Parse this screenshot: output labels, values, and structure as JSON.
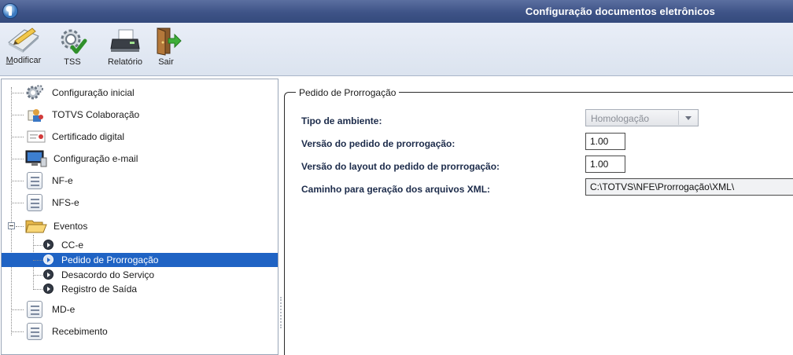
{
  "window": {
    "title": "Configuração documentos eletrônicos"
  },
  "toolbar": {
    "modificar": {
      "label_underlined": "M",
      "label_rest": "odificar",
      "icon": "pencil-check-icon"
    },
    "tss": {
      "label": "TSS",
      "icon": "gear-check-icon"
    },
    "relatorio": {
      "label": "Relatório",
      "icon": "printer-icon"
    },
    "sair": {
      "label": "Sair",
      "icon": "exit-door-icon"
    }
  },
  "tree": {
    "items": [
      {
        "label": "Configuração inicial",
        "icon": "gears-icon"
      },
      {
        "label": "TOTVS Colaboração",
        "icon": "collaboration-icon"
      },
      {
        "label": "Certificado digital",
        "icon": "certificate-icon"
      },
      {
        "label": "Configuração e-mail",
        "icon": "computer-icon"
      },
      {
        "label": "NF-e",
        "icon": "document-list-icon"
      },
      {
        "label": "NFS-e",
        "icon": "document-list-icon"
      },
      {
        "label": "Eventos",
        "icon": "folder-open-icon",
        "expanded": true
      },
      {
        "label": "CC-e",
        "icon": "arrow-circle-icon"
      },
      {
        "label": "Pedido de Prorrogação",
        "icon": "arrow-circle-icon",
        "selected": true
      },
      {
        "label": "Desacordo do Serviço",
        "icon": "arrow-circle-icon"
      },
      {
        "label": "Registro de Saída",
        "icon": "arrow-circle-icon"
      },
      {
        "label": "MD-e",
        "icon": "document-list-icon"
      },
      {
        "label": "Recebimento",
        "icon": "document-list-icon"
      }
    ]
  },
  "form": {
    "group_title": "Pedido de Prorrogação",
    "tipo_ambiente": {
      "label": "Tipo de ambiente:",
      "value": "Homologação"
    },
    "versao_pedido": {
      "label": "Versão do pedido de prorrogação:",
      "value": "1.00"
    },
    "versao_layout": {
      "label": "Versão do layout do pedido de prorrogação:",
      "value": "1.00"
    },
    "caminho_xml": {
      "label": "Caminho para geração dos arquivos XML:",
      "value": "C:\\TOTVS\\NFE\\Prorrogação\\XML\\"
    }
  },
  "colors": {
    "titlebar": "#3e5387",
    "selection": "#1f63c4",
    "label_text": "#1c2b4a"
  }
}
